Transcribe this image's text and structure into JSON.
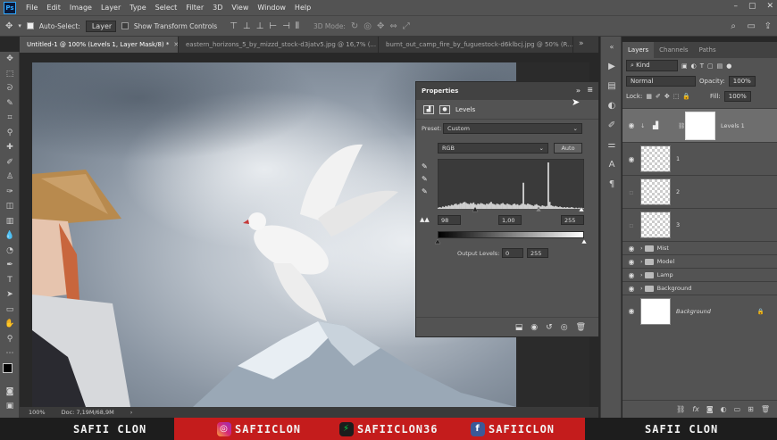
{
  "app": {
    "logo": "Ps"
  },
  "menubar": {
    "items": [
      "File",
      "Edit",
      "Image",
      "Layer",
      "Type",
      "Select",
      "Filter",
      "3D",
      "View",
      "Window",
      "Help"
    ]
  },
  "options": {
    "auto_select_label": "Auto-Select:",
    "auto_select_value": "Layer",
    "transform_label": "Show Transform Controls",
    "mode_3d": "3D Mode:"
  },
  "tabs": [
    {
      "label": "Untitled-1 @ 100% (Levels 1, Layer Mask/8) *",
      "active": true
    },
    {
      "label": "eastern_horizons_5_by_mizzd_stock-d3jatv5.jpg @ 16,7% (...",
      "active": false
    },
    {
      "label": "burnt_out_camp_fire_by_fuguestock-d6klbcj.jpg @ 50% (R...",
      "active": false
    }
  ],
  "status": {
    "zoom": "100%",
    "doc": "Doc: 7,19M/68,9M"
  },
  "properties": {
    "title": "Properties",
    "header_label": "Levels",
    "preset_label": "Preset:",
    "preset_value": "Custom",
    "channel_value": "RGB",
    "auto_label": "Auto",
    "input_black": "98",
    "input_gray": "1,00",
    "input_white": "255",
    "output_label": "Output Levels:",
    "output_black": "0",
    "output_white": "255",
    "histogram": [
      2,
      3,
      2,
      4,
      3,
      5,
      4,
      6,
      5,
      7,
      6,
      8,
      9,
      7,
      8,
      10,
      9,
      11,
      12,
      10,
      9,
      8,
      10,
      9,
      11,
      8,
      7,
      9,
      8,
      10,
      9,
      8,
      7,
      9,
      8,
      10,
      12,
      9,
      8,
      7,
      9,
      8,
      7,
      9,
      10,
      8,
      7,
      9,
      8,
      7,
      6,
      8,
      9,
      7,
      8,
      6,
      7,
      9,
      45,
      8,
      7,
      9,
      8,
      7,
      6,
      5,
      7,
      8,
      6,
      5,
      4,
      6,
      5,
      4,
      5,
      80,
      12,
      6,
      5,
      4,
      5,
      4,
      3,
      4,
      3,
      2,
      3,
      2,
      3,
      2,
      2,
      3,
      2,
      1,
      2,
      1,
      2,
      1,
      1,
      1
    ]
  },
  "layers_panel": {
    "tabs": [
      "Layers",
      "Channels",
      "Paths"
    ],
    "filter_kind": "Kind",
    "blend_mode": "Normal",
    "opacity_label": "Opacity:",
    "opacity_value": "100%",
    "lock_label": "Lock:",
    "fill_label": "Fill:",
    "fill_value": "100%",
    "layers": [
      {
        "name": "Levels 1",
        "type": "adjustment"
      },
      {
        "name": "1",
        "type": "pixel"
      },
      {
        "name": "2",
        "type": "pixel"
      },
      {
        "name": "3",
        "type": "pixel"
      },
      {
        "name": "Mist",
        "type": "group"
      },
      {
        "name": "Model",
        "type": "group"
      },
      {
        "name": "Lamp",
        "type": "group"
      },
      {
        "name": "Background",
        "type": "group"
      },
      {
        "name": "Background",
        "type": "background"
      }
    ]
  },
  "banner": {
    "left": "SAFII CLON",
    "instagram": "SAFIICLON",
    "deviantart": "SAFIICLON36",
    "facebook": "SAFIICLON",
    "right": "SAFII CLON",
    "colors": {
      "red": "#c41c1c",
      "dark": "#1d1d1d"
    }
  }
}
